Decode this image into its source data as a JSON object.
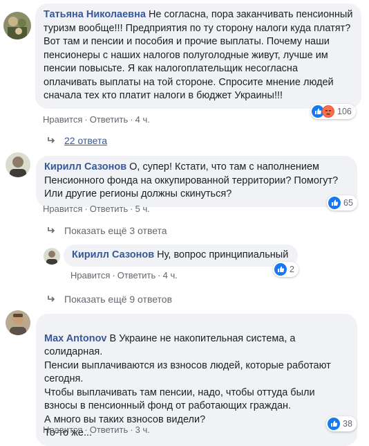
{
  "comments": [
    {
      "author": "Татьяна Николаевна",
      "text": "Не согласна, пора заканчивать пенсионный туризм вообще!!! Предприятия по ту сторону налоги куда платят? Вот там и пенсии и пособия и прочие выплаты. Почему наши пенсионеры с наших налогов полуголодные живут, лучше им пенсии повысьте. Я как налогоплательщик несогласна оплачивать выплаты на той стороне. Спросите мнение людей сначала тех кто платит налоги в бюджет Украины!!!",
      "like": "Нравится",
      "reply": "Ответить",
      "time": "4 ч.",
      "reactions": "106",
      "reaction_icons": [
        "like-icon",
        "angry-icon"
      ]
    },
    {
      "author": "Кирилл Сазонов",
      "text": "О, супер! Кстати, что там с наполнением Пенсионного фонда на оккупированной территории? Помогут? Или другие регионы должны скинуться?",
      "like": "Нравится",
      "reply": "Ответить",
      "time": "5 ч.",
      "reactions": "65",
      "reaction_icons": [
        "like-icon"
      ]
    },
    {
      "author": "Кирилл Сазонов",
      "text": "Ну, вопрос принципиальный",
      "like": "Нравится",
      "reply": "Ответить",
      "time": "4 ч.",
      "reactions": "2",
      "reaction_icons": [
        "like-icon"
      ]
    },
    {
      "author": "Max Antonov",
      "text": "В Украине не накопительная система, а солидарная.\nПенсии выплачиваются из взносов людей, которые работают сегодня.\nЧтобы выплачивать там пенсии, надо, чтобы оттуда были взносы в пенсионный фонд от работающих граждан.\nА много вы таких взносов видели?\nТо-то же...",
      "like": "Нравится",
      "reply": "Ответить",
      "time": "3 ч.",
      "reactions": "38",
      "reaction_icons": [
        "like-icon"
      ]
    }
  ],
  "reply_links": {
    "replies_22": "22 ответа",
    "more_3": "Показать ещё 3 ответа",
    "more_9": "Показать ещё 9 ответов"
  },
  "colors": {
    "author": "#365899",
    "bubble": "#f0f2f5",
    "like_blue": "#1877f2",
    "meta": "#606770"
  }
}
